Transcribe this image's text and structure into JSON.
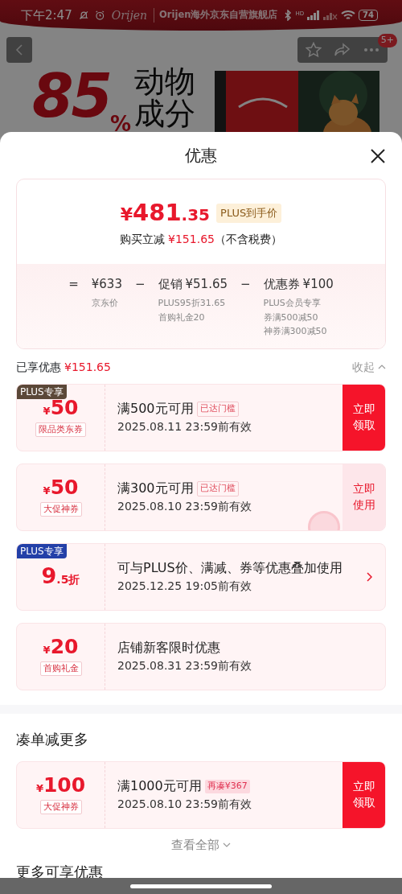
{
  "status_bar": {
    "time": "下午2:47",
    "battery": "74",
    "hd_label": "HD"
  },
  "store_banner": {
    "logo_text": "Orijen",
    "store_name": "Orijen海外京东自营旗舰店"
  },
  "top_actions": {
    "badge": "5+"
  },
  "hero": {
    "big_number": "85",
    "percent": "%",
    "tagline": "动物成分"
  },
  "sheet": {
    "title": "优惠",
    "summary": {
      "price_symbol": "¥",
      "price_int": "481",
      "price_dec": ".35",
      "price_tag": "PLUS到手价",
      "save_label": "购买立减",
      "save_amount": "¥151.65",
      "save_note": "（不含税费）",
      "breakdown": [
        {
          "operator": "=",
          "amount": "¥633",
          "notes": [
            "京东价"
          ]
        },
        {
          "operator": "−",
          "label": "促销",
          "amount": "¥51.65",
          "notes": [
            "PLUS95折31.65",
            "首购礼金20"
          ]
        },
        {
          "operator": "−",
          "label": "优惠券",
          "amount": "¥100",
          "notes": [
            "PLUS会员专享券满500减50",
            "神券满300减50"
          ]
        }
      ]
    },
    "enjoyed": {
      "label": "已享优惠",
      "amount": "¥151.65",
      "toggle": "收起",
      "expanded": true
    },
    "coupons": [
      {
        "kind": "cash",
        "tag": {
          "text": "PLUS专享",
          "color": "#5b4838"
        },
        "symbol": "¥",
        "amount": "50",
        "label": "限品类东券",
        "condition": "满500元可用",
        "status": {
          "text": "已达门槛",
          "kind": "outline"
        },
        "validity": "2025.08.11 23:59前有效",
        "action": {
          "text": "立即领取",
          "kind": "filled"
        },
        "stamped": false
      },
      {
        "kind": "cash",
        "symbol": "¥",
        "amount": "50",
        "label": "大促神券",
        "condition": "满300元可用",
        "status": {
          "text": "已达门槛",
          "kind": "outline"
        },
        "validity": "2025.08.10 23:59前有效",
        "action": {
          "text": "立即使用",
          "kind": "light"
        },
        "stamped": true
      },
      {
        "kind": "discount",
        "tag": {
          "text": "PLUS专享",
          "color": "#2340a8"
        },
        "amount": "9",
        "suffix": ".5折",
        "condition": "可与PLUS价、满减、券等优惠叠加使用",
        "validity": "2025.12.25 19:05前有效",
        "action": {
          "kind": "chevron"
        },
        "stamped": false
      },
      {
        "kind": "cash",
        "symbol": "¥",
        "amount": "20",
        "label": "首购礼金",
        "condition": "店铺新客限时优惠",
        "validity": "2025.08.31 23:59前有效",
        "stamped": false
      }
    ],
    "more_section": {
      "title": "凑单减更多",
      "coupons": [
        {
          "kind": "cash",
          "symbol": "¥",
          "amount": "100",
          "label": "大促神券",
          "condition": "满1000元可用",
          "status": {
            "text": "再凑¥367",
            "kind": "filled"
          },
          "validity": "2025.08.10 23:59前有效",
          "action": {
            "text": "立即领取",
            "kind": "filled"
          },
          "stamped": false
        }
      ],
      "view_all": "查看全部"
    },
    "next_section": {
      "title": "更多可享优惠"
    }
  }
}
